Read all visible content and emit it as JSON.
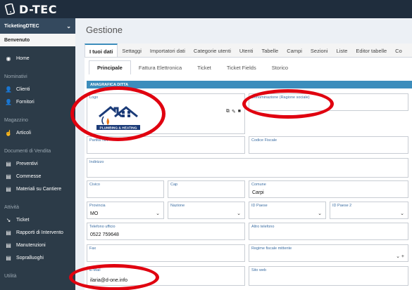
{
  "app": {
    "brand": "D-TEC"
  },
  "sidebar": {
    "tenant": "TicketingDTEC",
    "welcome": "Benvenuto",
    "home": "Home",
    "sections": {
      "nominativi": "Nominativi",
      "magazzino": "Magazzino",
      "documenti": "Documenti di Vendita",
      "attivita": "Attività",
      "utilita": "Utilità"
    },
    "items": {
      "clienti": "Clienti",
      "fornitori": "Fornitori",
      "articoli": "Articoli",
      "preventivi": "Preventivi",
      "commesse": "Commesse",
      "materiali": "Materiali su Cantiere",
      "ticket": "Ticket",
      "rapporti": "Rapporti di Intervento",
      "manutenzioni": "Manutenzioni",
      "sopralluoghi": "Sopralluoghi"
    }
  },
  "main": {
    "title": "Gestione",
    "tabs": [
      "I tuoi dati",
      "Settaggi",
      "Importatori dati",
      "Categorie utenti",
      "Utenti",
      "Tabelle",
      "Campi",
      "Sezioni",
      "Liste",
      "Editor tabelle",
      "Co"
    ],
    "subtabs": [
      "Principale",
      "Fattura Elettronica",
      "Ticket",
      "Ticket Fields",
      "Storico"
    ],
    "section_title": "ANAGRAFICA DITTA"
  },
  "form": {
    "logo_label": "Logo",
    "logo_text": "PLUMBING & HEATING",
    "denominazione_label": "Denominazione (Ragione sociale)",
    "denominazione_value": "",
    "partita_iva_label": "Partita IVA",
    "codice_fiscale_label": "Codice Fiscale",
    "indirizzo_label": "Indirizzo",
    "civico_label": "Civico",
    "cap_label": "Cap",
    "comune_label": "Comune",
    "comune_value": "Carpi",
    "provincia_label": "Provincia",
    "provincia_value": "MO",
    "nazione_label": "Nazione",
    "id_paese_label": "ID Paese",
    "id_paese2_label": "ID Paese 2",
    "telefono_label": "Telefono ufficio",
    "telefono_value": "0522 759648",
    "altro_tel_label": "Altro telefono",
    "fax_label": "Fax",
    "regime_label": "Regime fiscale mittente",
    "email_label": "E-Mail",
    "email_value": "ilaria@d-one.info",
    "sito_label": "Sito web"
  },
  "colors": {
    "accent": "#3c8dbc",
    "sidebar": "#2c3b48",
    "topbar": "#1f2d3d",
    "annotation": "#e0000f"
  }
}
